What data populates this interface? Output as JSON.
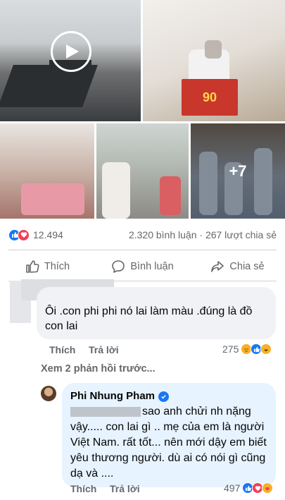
{
  "post": {
    "photos": {
      "more_count": "+7",
      "box_label": "90"
    },
    "reactions": {
      "count": "12.494",
      "comments": "2.320 bình luận",
      "shares": "267 lượt chia sẻ"
    },
    "actions": {
      "like": "Thích",
      "comment": "Bình luận",
      "share": "Chia sẻ"
    }
  },
  "comment": {
    "text": "Ôi .con phi phi nó lai làm màu .đúng là đồ con lai",
    "like": "Thích",
    "reply": "Trả lời",
    "reaction_count": "275"
  },
  "view_previous": "Xem 2 phản hồi trước...",
  "reply": {
    "author": "Phi Nhung Pham",
    "text": "sao anh chửi nh nặng vậy..... con lai gì .. mẹ của em là người Việt Nam. rất tốt... nên mới dậy em biết yêu thương người. dù ai có nói gì cũng dạ và ....",
    "like": "Thích",
    "reply": "Trả lời",
    "reaction_count": "497"
  },
  "colors": {
    "accent": "#1877f2",
    "love": "#f33e58",
    "muted": "#65676b",
    "bubble": "#f0f2f5",
    "reply_bubble": "#e7f3ff"
  }
}
